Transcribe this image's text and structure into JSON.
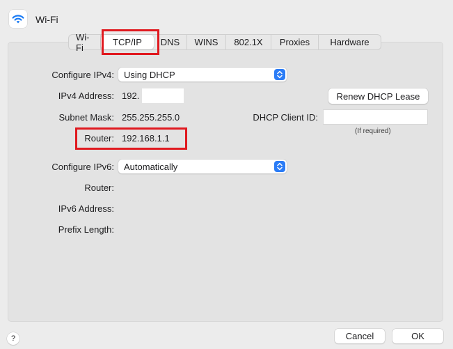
{
  "window": {
    "title": "Wi-Fi",
    "icon": "wifi-icon",
    "accent_color": "#1c7cf4",
    "highlight_color": "#e0191f"
  },
  "tabs": [
    {
      "label": "Wi-Fi",
      "active": false
    },
    {
      "label": "TCP/IP",
      "active": true
    },
    {
      "label": "DNS",
      "active": false
    },
    {
      "label": "WINS",
      "active": false
    },
    {
      "label": "802.1X",
      "active": false
    },
    {
      "label": "Proxies",
      "active": false
    },
    {
      "label": "Hardware",
      "active": false
    }
  ],
  "ipv4": {
    "configure_label": "Configure IPv4:",
    "configure_value": "Using DHCP",
    "address_label": "IPv4 Address:",
    "address_value": "192.",
    "subnet_label": "Subnet Mask:",
    "subnet_value": "255.255.255.0",
    "router_label": "Router:",
    "router_value": "192.168.1.1",
    "renew_button": "Renew DHCP Lease",
    "dhcp_client_id_label": "DHCP Client ID:",
    "dhcp_client_id_value": "",
    "dhcp_client_id_note": "(If required)"
  },
  "ipv6": {
    "configure_label": "Configure IPv6:",
    "configure_value": "Automatically",
    "router_label": "Router:",
    "address_label": "IPv6 Address:",
    "prefix_label": "Prefix Length:"
  },
  "footer": {
    "help_label": "?",
    "cancel_button": "Cancel",
    "ok_button": "OK"
  }
}
